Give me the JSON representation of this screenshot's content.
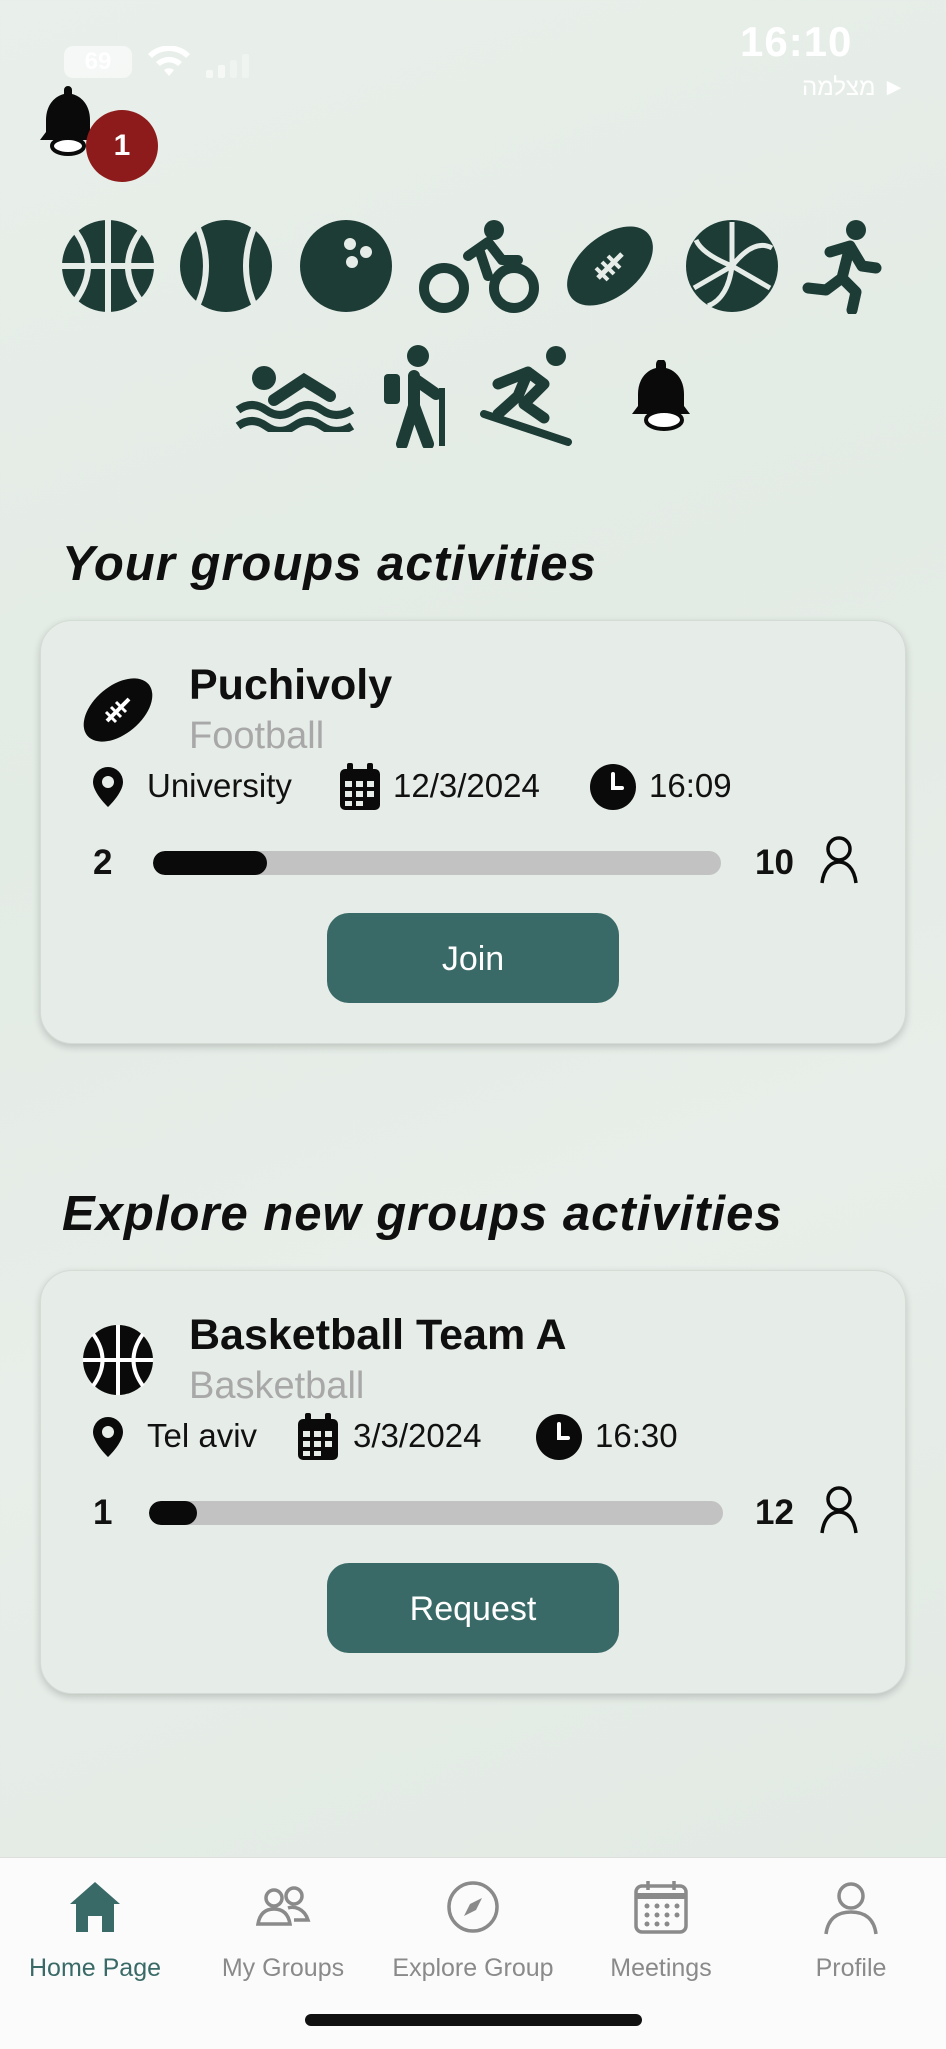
{
  "status_bar": {
    "time": "16:10",
    "carrier": "מצלמה ►",
    "battery": "69"
  },
  "notifications": {
    "badge_count": "1"
  },
  "sports_icons": [
    "basketball-icon",
    "baseball-icon",
    "bowling-icon",
    "cycling-icon",
    "football-icon",
    "volleyball-icon",
    "running-icon",
    "swimming-icon",
    "hiking-icon",
    "snowboarding-icon",
    "bell-icon"
  ],
  "your_groups": {
    "title": "Your groups activities",
    "card": {
      "icon": "football-icon",
      "name": "Puchivoly",
      "sport": "Football",
      "location": "University",
      "date": "12/3/2024",
      "time": "16:09",
      "current": "2",
      "max": "10",
      "fill_fraction": 0.2,
      "button": "Join"
    }
  },
  "explore_groups": {
    "title": "Explore new groups activities",
    "card": {
      "icon": "basketball-icon",
      "name": "Basketball Team A",
      "sport": "Basketball",
      "location": "Tel aviv",
      "date": "3/3/2024",
      "time": "16:30",
      "current": "1",
      "max": "12",
      "fill_fraction": 0.083,
      "button": "Request"
    }
  },
  "nav": {
    "items": [
      {
        "label": "Home Page",
        "icon": "home-icon",
        "active": true
      },
      {
        "label": "My Groups",
        "icon": "groups-icon",
        "active": false
      },
      {
        "label": "Explore Group",
        "icon": "compass-icon",
        "active": false
      },
      {
        "label": "Meetings",
        "icon": "calendar-icon",
        "active": false
      },
      {
        "label": "Profile",
        "icon": "profile-icon",
        "active": false
      }
    ]
  },
  "colors": {
    "accent": "#3a6a67",
    "icon_dark": "#1e3c36",
    "badge": "#8e1b1b"
  }
}
